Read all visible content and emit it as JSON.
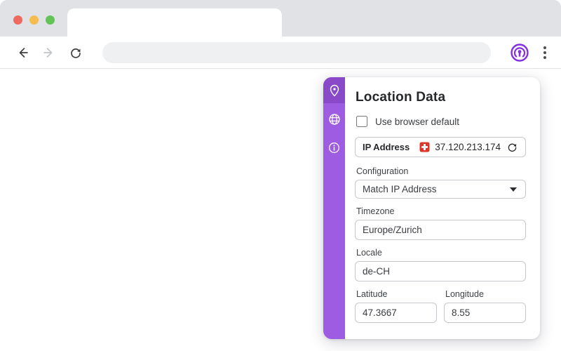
{
  "browser": {
    "address_bar": {
      "value": "",
      "placeholder": ""
    },
    "tab_title": ""
  },
  "popup": {
    "title": "Location Data",
    "use_default": {
      "label": "Use browser default",
      "checked": false
    },
    "ip": {
      "label": "IP Address",
      "value": "37.120.213.174",
      "country_code": "CH"
    },
    "configuration": {
      "label": "Configuration",
      "value": "Match IP Address"
    },
    "timezone": {
      "label": "Timezone",
      "value": "Europe/Zurich"
    },
    "locale": {
      "label": "Locale",
      "value": "de-CH"
    },
    "latitude": {
      "label": "Latitude",
      "value": "47.3667"
    },
    "longitude": {
      "label": "Longitude",
      "value": "8.55"
    }
  },
  "colors": {
    "accent_purple": "#9e5ce2",
    "accent_purple_dark": "#8a49c9",
    "brand_icon_purple": "#8430e0",
    "flag_red": "#e23328",
    "traffic_red": "#ee6a5e",
    "traffic_yellow": "#f5bd50",
    "traffic_green": "#61c454"
  }
}
